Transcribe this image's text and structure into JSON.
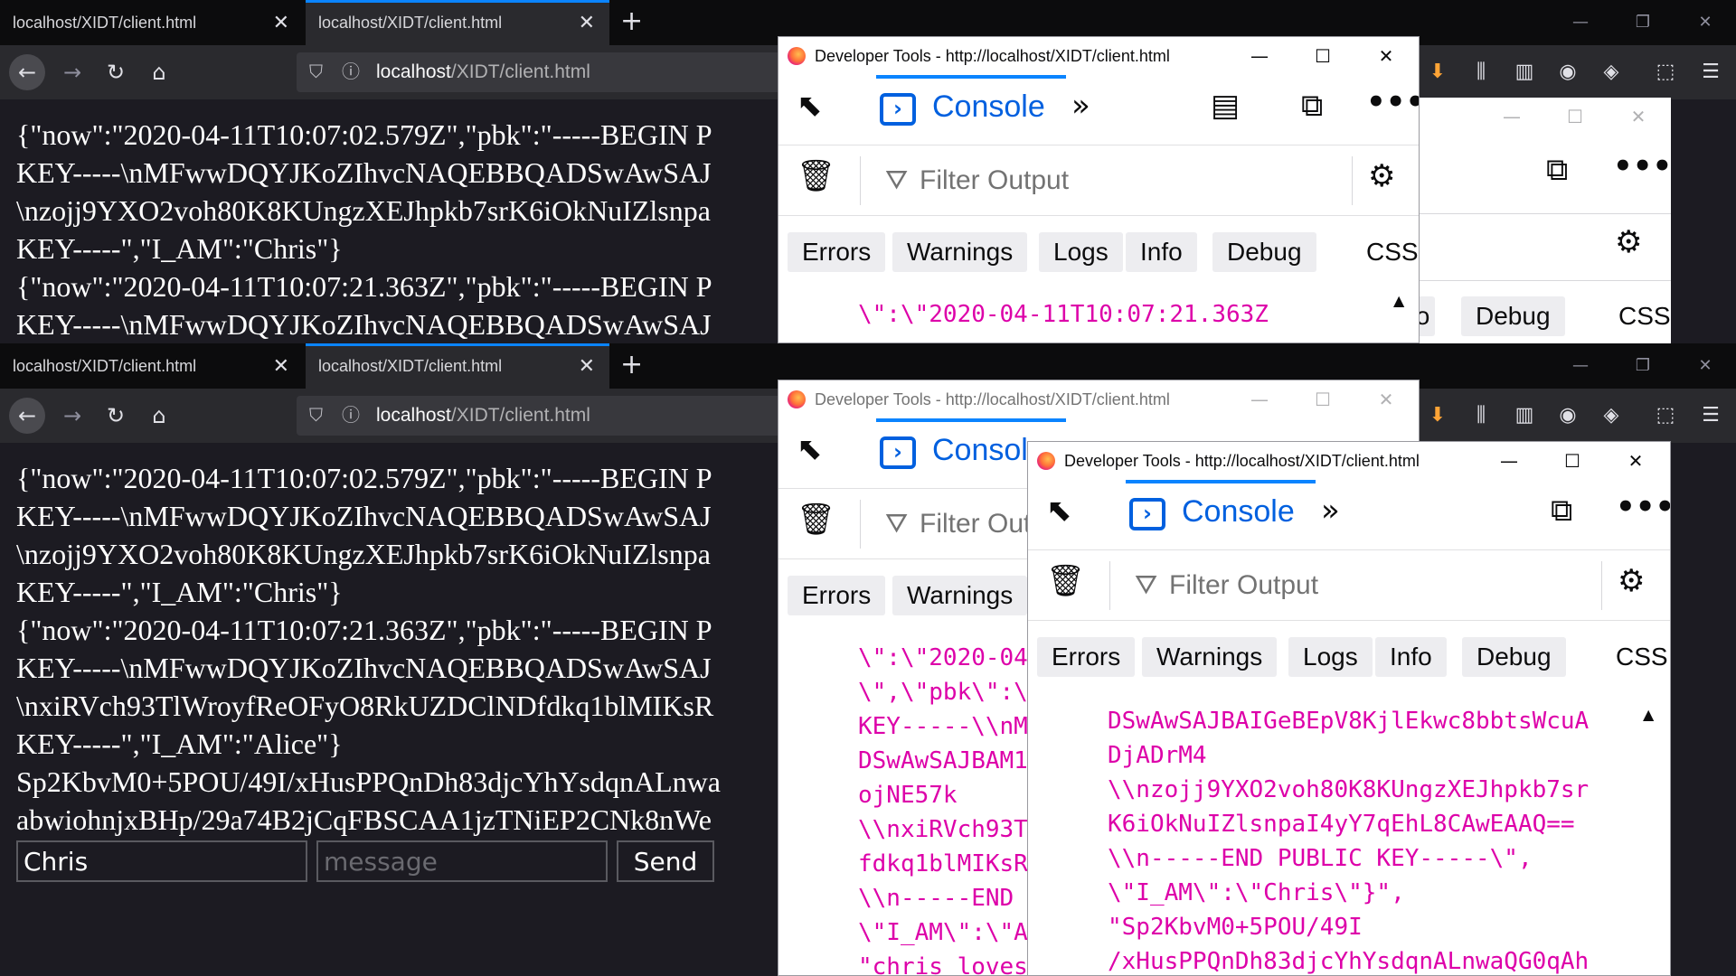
{
  "top_browser": {
    "tabs": [
      {
        "title": "localhost/XIDT/client.html"
      },
      {
        "title": "localhost/XIDT/client.html"
      }
    ],
    "url_host": "localhost",
    "url_path": "/XIDT/client.html",
    "page_lines": [
      "{\"now\":\"2020-04-11T10:07:02.579Z\",\"pbk\":\"-----BEGIN P",
      "KEY-----\\nMFwwDQYJKoZIhvcNAQEBBQADSwAwSAJ",
      "\\nzojj9YXO2voh80K8KUngzXEJhpkb7srK6iOkNuIZlsnpa",
      "KEY-----\",\"I_AM\":\"Chris\"}",
      "{\"now\":\"2020-04-11T10:07:21.363Z\",\"pbk\":\"-----BEGIN P",
      "KEY-----\\nMFwwDQYJKoZIhvcNAQEBBQADSwAwSAJ"
    ]
  },
  "bottom_browser": {
    "tabs": [
      {
        "title": "localhost/XIDT/client.html"
      },
      {
        "title": "localhost/XIDT/client.html"
      }
    ],
    "url_host": "localhost",
    "url_path": "/XIDT/client.html",
    "page_lines": [
      "{\"now\":\"2020-04-11T10:07:02.579Z\",\"pbk\":\"-----BEGIN P",
      "KEY-----\\nMFwwDQYJKoZIhvcNAQEBBQADSwAwSAJ",
      "\\nzojj9YXO2voh80K8KUngzXEJhpkb7srK6iOkNuIZlsnpa",
      "KEY-----\",\"I_AM\":\"Chris\"}",
      "{\"now\":\"2020-04-11T10:07:21.363Z\",\"pbk\":\"-----BEGIN P",
      "KEY-----\\nMFwwDQYJKoZIhvcNAQEBBQADSwAwSAJ",
      "\\nxiRVch93TlWroyfReOFyO8RkUZDClNDfdkq1blMIKsR",
      "KEY-----\",\"I_AM\":\"Alice\"}",
      "Sp2KbvM0+5POU/49I/xHusPPQnDh83djcYhYsdqnALnwa",
      "abwiohnjxBHp/29a74B2jCqFBSCAA1jzTNiEP2CNk8nWe"
    ],
    "name_input_value": "Chris",
    "message_placeholder": "message",
    "send_label": "Send"
  },
  "devtools": {
    "title": "Developer Tools - http://localhost/XIDT/client.html",
    "console_label": "Console",
    "filter_placeholder": "Filter Output",
    "chips": {
      "errors": "Errors",
      "warnings": "Warnings",
      "logs": "Logs",
      "info": "Info",
      "debug": "Debug"
    },
    "css_label": "CSS",
    "top_output": [
      "\\\":\\\"2020-04-11T10:07:21.363Z"
    ],
    "bottom_partial_output": [
      "\\\":\\\"2020-04",
      "\\\",\\\"pbk\\\":\\",
      "KEY-----\\\\nM",
      "DSwAwSAJBAM1",
      "ojNE57k",
      "\\\\nxiRVch93T",
      "fdkq1blMIKsR",
      "\\\\n-----END",
      "\\\"I_AM\\\":\\\"A",
      "\"chris loves"
    ],
    "front_output": [
      "DSwAwSAJBAIGeBEpV8KjlEkwc8bbtsWcuA",
      "DjADrM4",
      "\\\\nzojj9YXO2voh80K8KUngzXEJhpkb7sr",
      "K6iOkNuIZlsnpaI4yY7qEhL8CAwEAAQ==",
      "\\\\n-----END PUBLIC KEY-----\\\",",
      "\\\"I_AM\\\":\\\"Chris\\\"}\",",
      "\"Sp2KbvM0+5POU/49I",
      "/xHusPPQnDh83djcYhYsdqnALnwaQG0qAh"
    ],
    "side_panel": {
      "info_fragment": "fo",
      "debug": "Debug",
      "css": "CSS"
    }
  }
}
